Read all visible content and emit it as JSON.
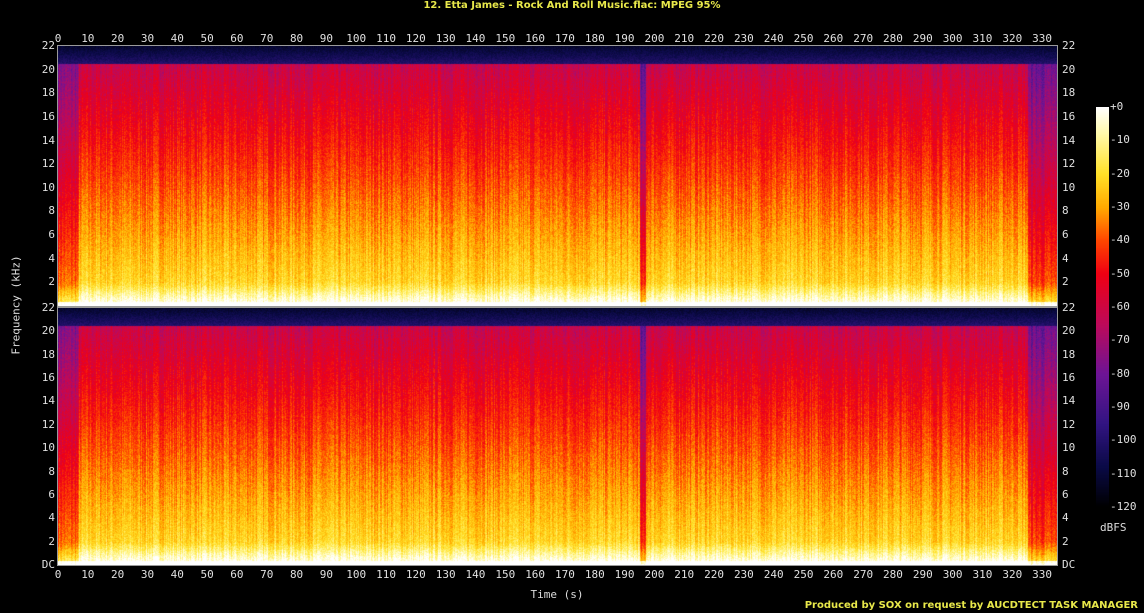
{
  "title": "12. Etta James - Rock And Roll Music.flac: MPEG 95%",
  "footer": "Produced by SOX on request by AUCDTECT TASK MANAGER",
  "chart_data": {
    "type": "heatmap",
    "title": "12. Etta James - Rock And Roll Music.flac: MPEG 95%",
    "xlabel": "Time (s)",
    "ylabel": "Frequency (kHz)",
    "xlim": [
      0,
      335
    ],
    "ylim": [
      0,
      22
    ],
    "x_ticks": [
      0,
      10,
      20,
      30,
      40,
      50,
      60,
      70,
      80,
      90,
      100,
      110,
      120,
      130,
      140,
      150,
      160,
      170,
      180,
      190,
      200,
      210,
      220,
      230,
      240,
      250,
      260,
      270,
      280,
      290,
      300,
      310,
      320,
      330
    ],
    "y_ticks": [
      "DC",
      "2",
      "4",
      "6",
      "8",
      "10",
      "12",
      "14",
      "16",
      "18",
      "20",
      "22"
    ],
    "channels": [
      "channel 1",
      "channel 2"
    ],
    "colorbar": {
      "label": "dBFS",
      "ticks": [
        "+0",
        "-10",
        "-20",
        "-30",
        "-40",
        "-50",
        "-60",
        "-70",
        "-80",
        "-90",
        "-100",
        "-110",
        "-120"
      ],
      "range": [
        -120,
        0
      ]
    },
    "segments": [
      {
        "start": 0,
        "end": 7,
        "level_db": -60
      },
      {
        "start": 7,
        "end": 195,
        "level_db": -45
      },
      {
        "start": 195,
        "end": 197,
        "level_db": -70
      },
      {
        "start": 197,
        "end": 325,
        "level_db": -45
      },
      {
        "start": 325,
        "end": 335,
        "level_db": -65
      }
    ],
    "cutoff_khz": 20.5
  }
}
